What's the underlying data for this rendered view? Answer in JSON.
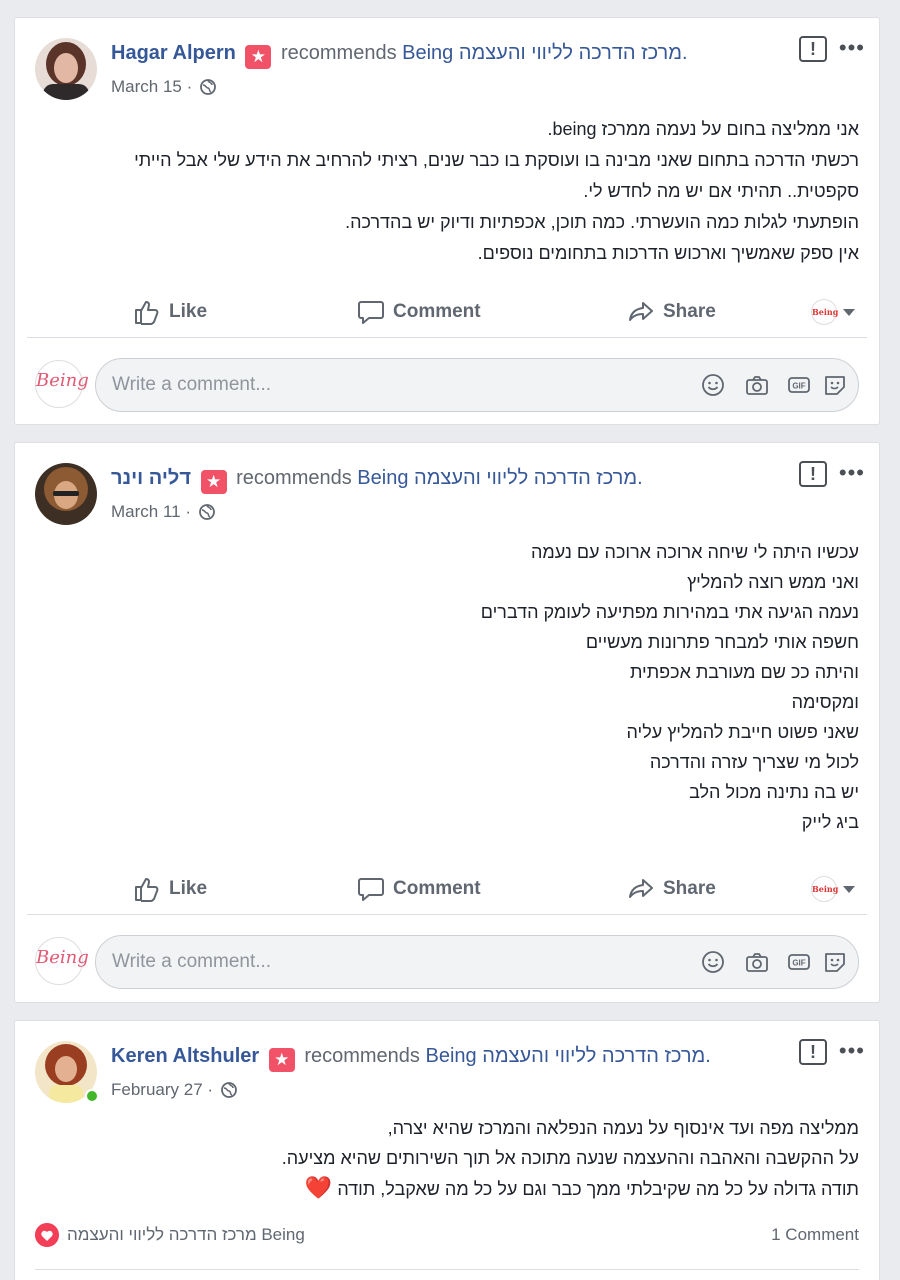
{
  "posts": [
    {
      "author": "Hagar Alpern",
      "recommends": "recommends",
      "page": "Being מרכז הדרכה לליווי והעצמה.",
      "date": "March 15 ·",
      "body": [
        "אני ממליצה בחום על נעמה ממרכז being.",
        "רכשתי הדרכה בתחום שאני מבינה בו ועוסקת בו כבר שנים, רציתי להרחיב את הידע שלי אבל הייתי",
        "סקפטית.. תהיתי אם יש מה לחדש לי.",
        "הופתעתי לגלות כמה הועשרתי. כמה תוכן, אכפתיות ודיוק יש בהדרכה.",
        "אין ספק שאמשיך וארכוש הדרכות בתחומים נוספים."
      ],
      "actions": {
        "like": "Like",
        "comment": "Comment",
        "share": "Share"
      },
      "comment_placeholder": "Write a comment...",
      "avatar_colors": [
        "#7a4a3a",
        "#c89a86"
      ]
    },
    {
      "author": "דליה וינר",
      "recommends": "recommends",
      "page": "Being מרכז הדרכה לליווי והעצמה.",
      "date": "March 11 ·",
      "body": [
        "עכשיו היתה לי שיחה ארוכה ארוכה עם נעמה",
        "ואני ממש רוצה להמליץ",
        "נעמה הגיעה אתי במהירות מפתיעה לעומק הדברים",
        "חשפה אותי למבחר פתרונות מעשיים",
        "והיתה ככ שם מעורבת אכפתית",
        "ומקסימה",
        "שאני פשוט חייבת להמליץ עליה",
        "לכול מי שצריך עזרה והדרכה",
        "יש בה נתינה מכול הלב",
        "ביג לייק"
      ],
      "actions": {
        "like": "Like",
        "comment": "Comment",
        "share": "Share"
      },
      "comment_placeholder": "Write a comment...",
      "avatar_colors": [
        "#6b4a2e",
        "#b98a5a"
      ]
    },
    {
      "author": "Keren Altshuler",
      "recommends": "recommends",
      "page": "Being מרכז הדרכה לליווי והעצמה.",
      "date": "February 27 ·",
      "body": [
        "ממליצה מפה ועד אינסוף על נעמה הנפלאה והמרכז שהיא יצרה,",
        "על ההקשבה והאהבה וההעצמה שנעה מתוכה אל תוך השירותים שהיא מציעה.",
        "תודה גדולה על כל מה שקיבלתי ממך כבר וגם על כל מה שאקבל, תודה"
      ],
      "heart": "❤️",
      "reaction_name": "מרכז הדרכה לליווי והעצמה Being",
      "comment_count": "1 Comment",
      "online": true,
      "avatar_colors": [
        "#8a3b26",
        "#d98a5a"
      ]
    }
  ],
  "icons": {
    "report": "!",
    "more": "•••",
    "recommend_star": "★",
    "comment_avatar_logo": "Being"
  },
  "colors": {
    "link": "#365899",
    "badge": "#f25268",
    "background": "#e9ebee"
  }
}
